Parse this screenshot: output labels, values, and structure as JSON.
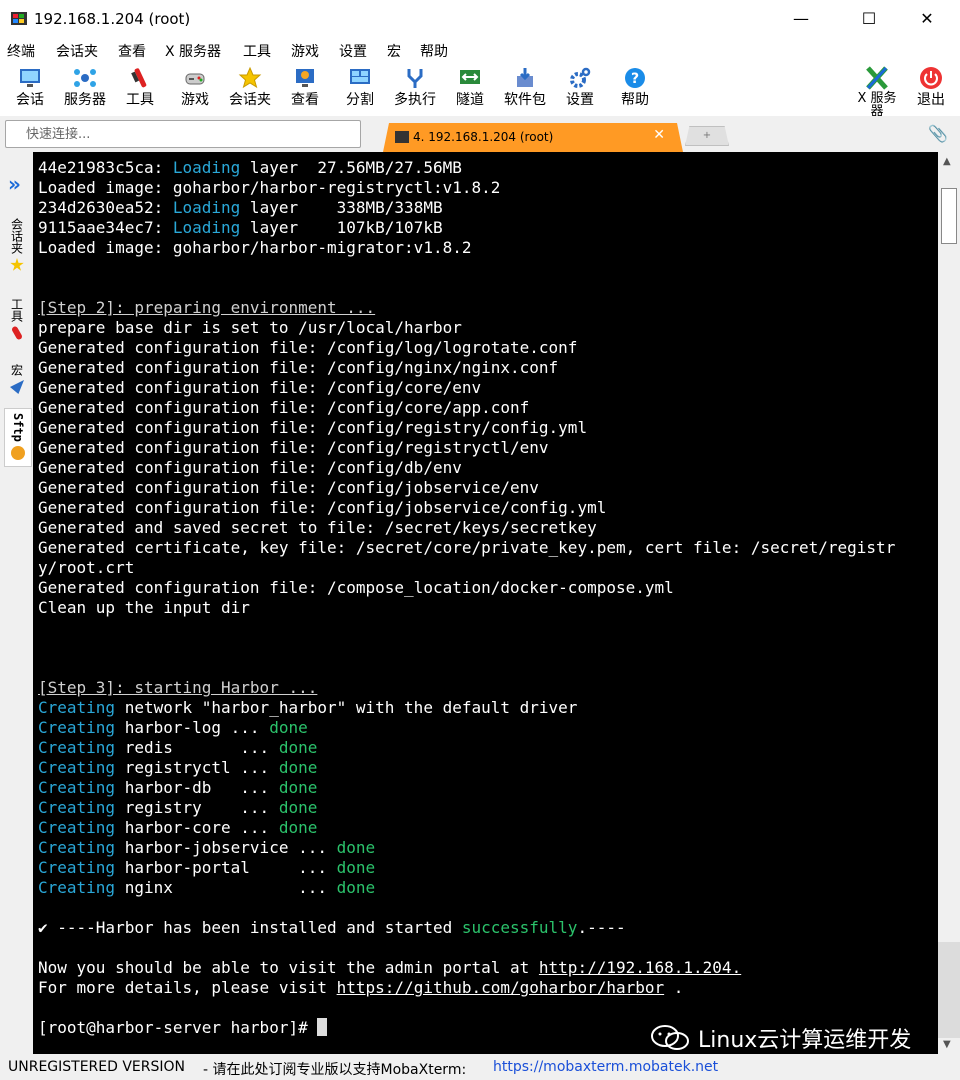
{
  "window": {
    "title": "192.168.1.204 (root)",
    "controls": {
      "minimize": "—",
      "maximize": "☐",
      "close": "✕"
    }
  },
  "menu": [
    "终端",
    "会话夹",
    "查看",
    "X 服务器",
    "工具",
    "游戏",
    "设置",
    "宏",
    "帮助"
  ],
  "toolbar": {
    "session": "会话",
    "servers": "服务器",
    "tools": "工具",
    "games": "游戏",
    "favorites": "会话夹",
    "view": "查看",
    "split": "分割",
    "multiexec": "多执行",
    "tunneling": "隧道",
    "packages": "软件包",
    "settings": "设置",
    "help": "帮助",
    "xserver_1": "X 服务",
    "xserver_2": "器",
    "exit": "退出"
  },
  "quick_connect": {
    "placeholder": "快速连接..."
  },
  "tabs": {
    "active": "4. 192.168.1.204 (root)",
    "close": "✕",
    "new": "+"
  },
  "sidebar": {
    "expand": "»",
    "favorites": "会话夹",
    "tools": "工具",
    "macros": "宏",
    "sftp": "Sftp"
  },
  "terminal": {
    "l1a": "44e21983c5ca: ",
    "l1b": "Loading",
    "l1c": " layer  27.56MB/27.56MB",
    "l2": "Loaded image: goharbor/harbor-registryctl:v1.8.2",
    "l3a": "234d2630ea52: ",
    "l3b": "Loading",
    "l3c": " layer    338MB/338MB",
    "l4a": "9115aae34ec7: ",
    "l4b": "Loading",
    "l4c": " layer    107kB/107kB",
    "l5": "Loaded image: goharbor/harbor-migrator:v1.8.2",
    "step2": "[Step 2]: preparing environment ...",
    "p1": "prepare base dir is set to /usr/local/harbor",
    "p2": "Generated configuration file: /config/log/logrotate.conf",
    "p3": "Generated configuration file: /config/nginx/nginx.conf",
    "p4": "Generated configuration file: /config/core/env",
    "p5": "Generated configuration file: /config/core/app.conf",
    "p6": "Generated configuration file: /config/registry/config.yml",
    "p7": "Generated configuration file: /config/registryctl/env",
    "p8": "Generated configuration file: /config/db/env",
    "p9": "Generated configuration file: /config/jobservice/env",
    "p10": "Generated configuration file: /config/jobservice/config.yml",
    "p11": "Generated and saved secret to file: /secret/keys/secretkey",
    "p12": "Generated certificate, key file: /secret/core/private_key.pem, cert file: /secret/registr",
    "p13": "y/root.crt",
    "p14": "Generated configuration file: /compose_location/docker-compose.yml",
    "p15": "Clean up the input dir",
    "step3": "[Step 3]: starting Harbor ...",
    "creating": "Creating",
    "c1": " network \"harbor_harbor\" with the default driver",
    "c2": " harbor-log ... ",
    "c3": " redis       ... ",
    "c4": " registryctl ... ",
    "c5": " harbor-db   ... ",
    "c6": " registry    ... ",
    "c7": " harbor-core ... ",
    "c8": " harbor-jobservice ... ",
    "c9": " harbor-portal     ... ",
    "c10": " nginx             ... ",
    "done": "done",
    "s1a": "✔ ----Harbor has been installed and started ",
    "s1b": "successfully",
    "s1c": ".----",
    "v1a": "Now you should be able to visit the admin portal at ",
    "v1b": "http://192.168.1.204.",
    "v2a": "For more details, please visit ",
    "v2b": "https://github.com/goharbor/harbor",
    "v2c": " .",
    "prompt": "[root@harbor-server harbor]# "
  },
  "status": {
    "unregistered": "UNREGISTERED VERSION",
    "message": "  -  请在此处订阅专业版以支持MobaXterm:",
    "link": "https://mobaxterm.mobatek.net"
  },
  "watermark": "Linux云计算运维开发",
  "colors": {
    "accent_tab": "#ff9a24",
    "terminal_bg": "#000000",
    "cyan": "#2aa8d8",
    "green": "#2bc26b"
  }
}
